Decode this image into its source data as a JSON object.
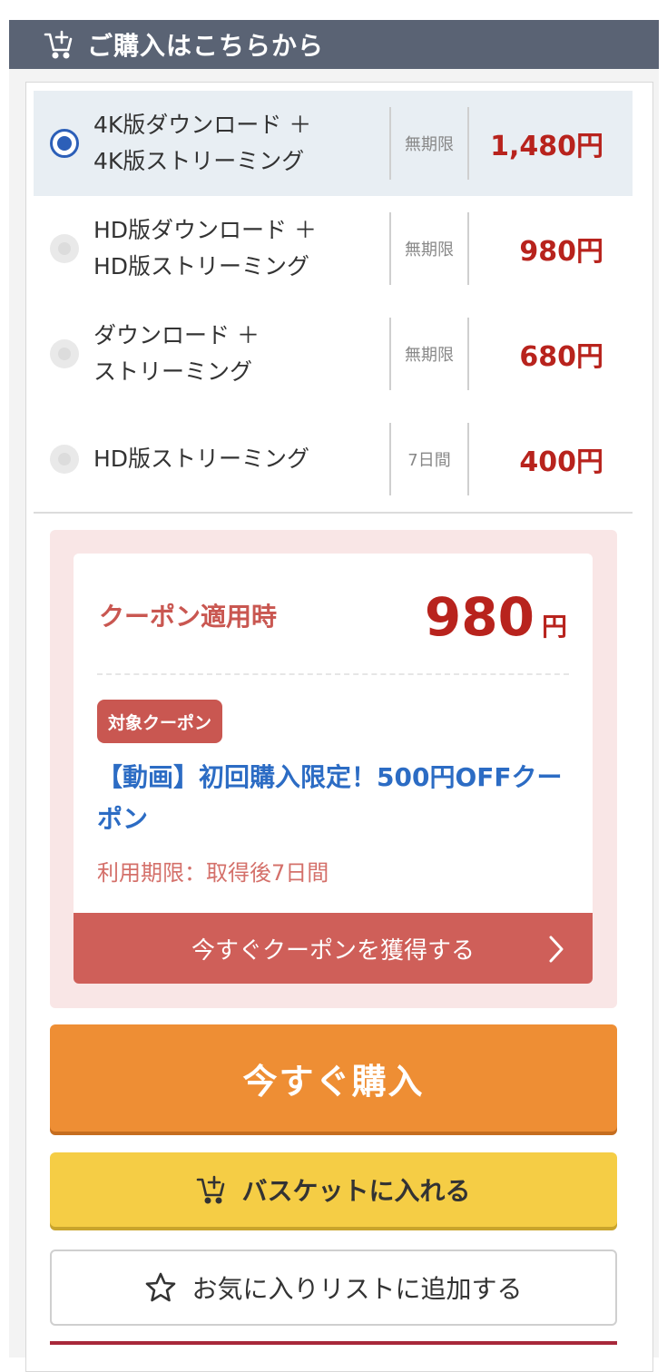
{
  "header": {
    "title": "ご購入はこちらから",
    "icon": "cart-plus-icon"
  },
  "options": [
    {
      "line1": "4K版ダウンロード ＋",
      "line2": "4K版ストリーミング",
      "period": "無期限",
      "price": "1,480円",
      "selected": true
    },
    {
      "line1": "HD版ダウンロード ＋",
      "line2": "HD版ストリーミング",
      "period": "無期限",
      "price": "980円",
      "selected": false
    },
    {
      "line1": "ダウンロード ＋",
      "line2": "ストリーミング",
      "period": "無期限",
      "price": "680円",
      "selected": false
    },
    {
      "line1": "HD版ストリーミング",
      "line2": "",
      "period": "7日間",
      "price": "400円",
      "selected": false
    }
  ],
  "coupon": {
    "label": "クーポン適用時",
    "price": "980",
    "unit": "円",
    "badge": "対象クーポン",
    "title": "【動画】初回購入限定！500円OFFクーポン",
    "expiry": "利用期限：取得後7日間",
    "button": "今すぐクーポンを獲得する"
  },
  "actions": {
    "buy": "今すぐ購入",
    "basket": "バスケットに入れる",
    "favorite": "お気に入りリストに追加する"
  },
  "colors": {
    "header_bg": "#5a6374",
    "price": "#b8231d",
    "coupon_accent": "#c95751",
    "coupon_title": "#2c6cc4",
    "buy": "#ee8e34",
    "basket": "#f5cd45",
    "radio_selected": "#2c5fb8"
  }
}
